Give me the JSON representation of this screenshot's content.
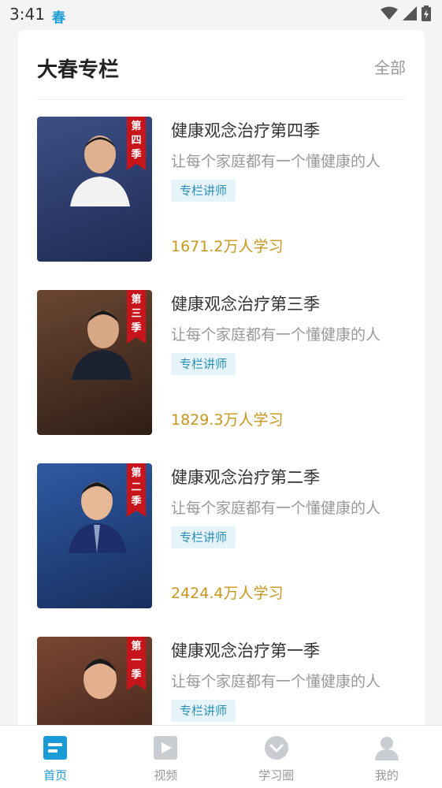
{
  "status_bar": {
    "time": "3:41",
    "app_icon": "春"
  },
  "section": {
    "title": "大春专栏",
    "all_label": "全部"
  },
  "courses": [
    {
      "title": "健康观念治疗第四季",
      "subtitle": "让每个家庭都有一个懂健康的人",
      "tag": "专栏讲师",
      "learners": "1671.2万人学习",
      "ribbon": "第四季",
      "cover_color": "#2d3e6e"
    },
    {
      "title": "健康观念治疗第三季",
      "subtitle": "让每个家庭都有一个懂健康的人",
      "tag": "专栏讲师",
      "learners": "1829.3万人学习",
      "ribbon": "第三季",
      "cover_color": "#5a3a2a"
    },
    {
      "title": "健康观念治疗第二季",
      "subtitle": "让每个家庭都有一个懂健康的人",
      "tag": "专栏讲师",
      "learners": "2424.4万人学习",
      "ribbon": "第二季",
      "cover_color": "#2b4f8f"
    },
    {
      "title": "健康观念治疗第一季",
      "subtitle": "让每个家庭都有一个懂健康的人",
      "tag": "专栏讲师",
      "learners": "",
      "ribbon": "第一季",
      "cover_color": "#6a3b2a"
    }
  ],
  "tabs": [
    {
      "label": "首页",
      "icon": "home-doc-icon",
      "active": true
    },
    {
      "label": "视频",
      "icon": "video-play-icon",
      "active": false
    },
    {
      "label": "学习圈",
      "icon": "chevron-circle-icon",
      "active": false
    },
    {
      "label": "我的",
      "icon": "user-icon",
      "active": false
    }
  ],
  "colors": {
    "accent": "#1a9ad6",
    "gold": "#c8961e",
    "ribbon": "#c8141b"
  }
}
